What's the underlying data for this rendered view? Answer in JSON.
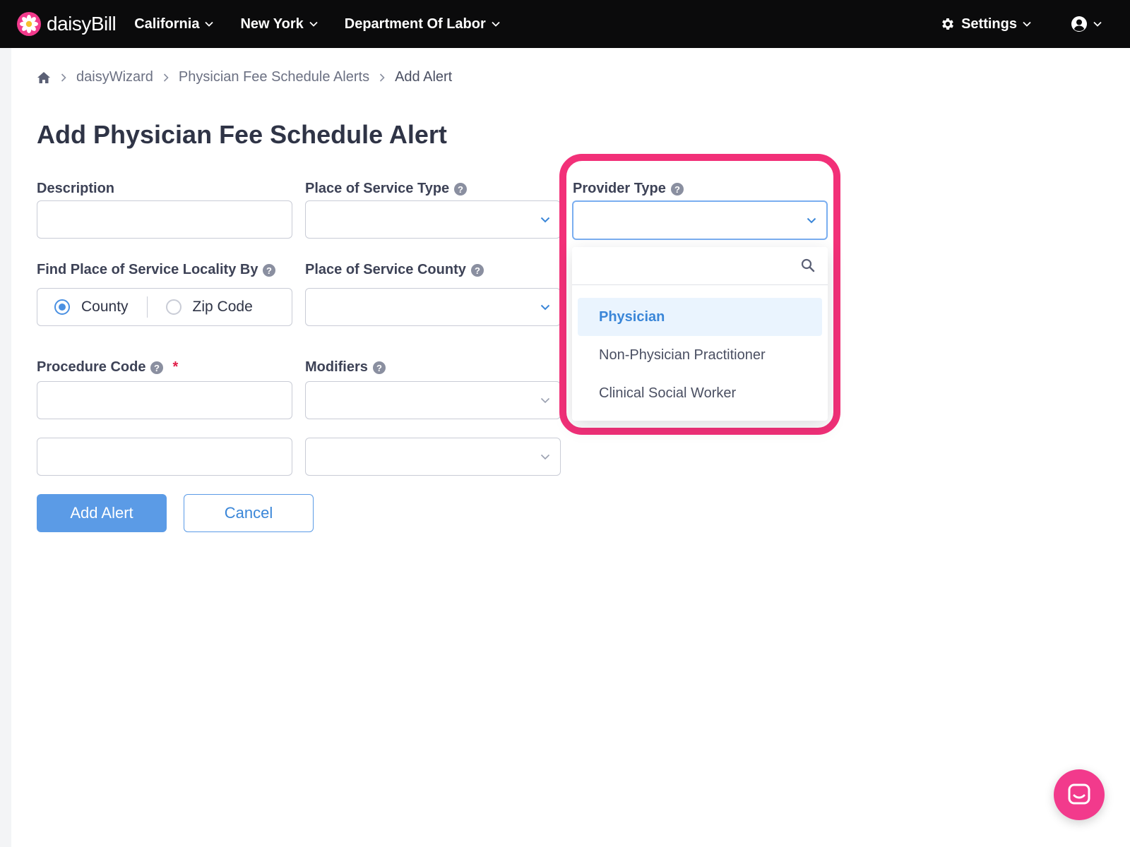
{
  "nav": {
    "logo_text": "daisyBill",
    "items": [
      {
        "label": "California"
      },
      {
        "label": "New York"
      },
      {
        "label": "Department Of Labor"
      }
    ],
    "settings_label": "Settings"
  },
  "breadcrumb": {
    "items": [
      "daisyWizard",
      "Physician Fee Schedule Alerts"
    ],
    "current": "Add Alert"
  },
  "page_title": "Add Physician Fee Schedule Alert",
  "form": {
    "description_label": "Description",
    "pos_type_label": "Place of Service Type",
    "provider_type_label": "Provider Type",
    "locality_label": "Find Place of Service Locality By",
    "locality_options": {
      "county": "County",
      "zip": "Zip Code"
    },
    "locality_selected": "County",
    "pos_county_label": "Place of Service County",
    "procedure_label": "Procedure Code",
    "required_mark": "*",
    "modifiers_label": "Modifiers"
  },
  "dropdown": {
    "options": [
      "Physician",
      "Non-Physician Practitioner",
      "Clinical Social Worker"
    ],
    "active": "Physician"
  },
  "buttons": {
    "add_alert": "Add Alert",
    "cancel": "Cancel"
  },
  "colors": {
    "primary": "#5b9be6",
    "highlight": "#f23078",
    "nav_bg": "#0b0b0c",
    "chat": "#f23a8c"
  }
}
